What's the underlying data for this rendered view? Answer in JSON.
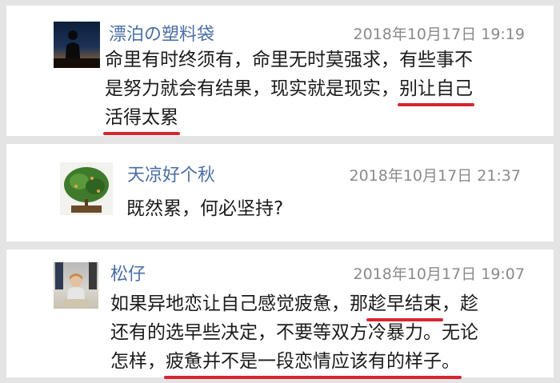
{
  "comments": [
    {
      "user": "漂泊の塑料袋",
      "time": "2018年10月17日 19:19",
      "lines": [
        {
          "pre": "命里有时终须有，命里无时莫强求，有些事不",
          "hl": "",
          "post": ""
        },
        {
          "pre": "是努力就会有结果，现实就是现实，",
          "hl": "别让自己",
          "post": ""
        },
        {
          "pre": "",
          "hl": "活得太累",
          "post": ""
        }
      ]
    },
    {
      "user": "天凉好个秋",
      "time": "2018年10月17日 21:37",
      "lines": [
        {
          "pre": "既然累，何必坚持?",
          "hl": "",
          "post": ""
        }
      ]
    },
    {
      "user": "松仔",
      "time": "2018年10月17日 19:07",
      "lines": [
        {
          "pre": "如果异地恋让自己感觉疲惫，那",
          "hl": "趁早结束",
          "post": "，趁"
        },
        {
          "pre": "还有的选早些决定，不要等双方冷暴力。无论",
          "hl": "",
          "post": ""
        },
        {
          "pre": "怎样，",
          "hl": "疲惫并不是一段恋情应该有的样子。",
          "post": ""
        }
      ]
    }
  ],
  "colors": {
    "background": "#e4e4e4",
    "card": "#ffffff",
    "username": "#4a6fa5",
    "timestamp": "#8a8a8a",
    "highlight_underline": "#d7262f"
  }
}
